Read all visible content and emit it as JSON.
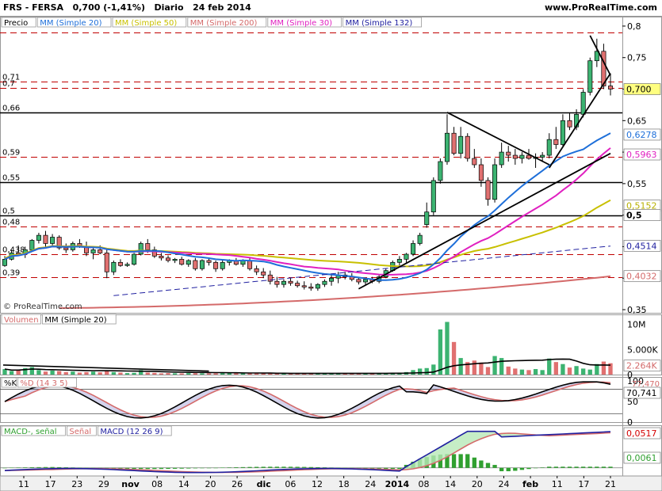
{
  "header": {
    "title": "FRS - FERSA",
    "price_change": "0,700 (-1,41%)",
    "period": "Diario",
    "date": "24 feb 2014",
    "site": "www.ProRealTime.com"
  },
  "price_legend": [
    {
      "label": "Precio",
      "color": "#000000"
    },
    {
      "label": "MM (Simple 20)",
      "color": "#1e6fd9"
    },
    {
      "label": "MM (Simple 50)",
      "color": "#c8c000"
    },
    {
      "label": "MM (Simple 200)",
      "color": "#d46a6a"
    },
    {
      "label": "MM (Simple 30)",
      "color": "#e020c0"
    },
    {
      "label": "MM (Simple 132)",
      "color": "#2020a0"
    }
  ],
  "price_axis_ticks": [
    "0,8",
    "0,75",
    "0,7",
    "0,65",
    "0,6",
    "0,55",
    "0,5",
    "0,45",
    "0,4",
    "0,35"
  ],
  "price_axis_markers": [
    {
      "label": "0,700",
      "bg": "#ffff80",
      "fg": "#000000",
      "value": 0.7
    },
    {
      "label": "0,6278",
      "bg": "#ffffff",
      "fg": "#1e6fd9",
      "value": 0.6278
    },
    {
      "label": "0,5963",
      "bg": "#ffffff",
      "fg": "#e020c0",
      "value": 0.5963
    },
    {
      "label": "0,5152",
      "bg": "#ffffff",
      "fg": "#b8b000",
      "value": 0.5152
    },
    {
      "label": "0,5",
      "bg": "#ffffff",
      "fg": "#000000",
      "value": 0.5
    },
    {
      "label": "0,4514",
      "bg": "#ffffff",
      "fg": "#2020a0",
      "value": 0.4514
    },
    {
      "label": "0,4032",
      "bg": "#ffffff",
      "fg": "#d46a6a",
      "value": 0.4032
    }
  ],
  "level_lines": [
    {
      "label": "0,71",
      "value": 0.712,
      "style": "dashed-red"
    },
    {
      "label": "0,7",
      "value": 0.702,
      "style": "dashed-red"
    },
    {
      "label": "0,66",
      "value": 0.663,
      "style": "solid-black"
    },
    {
      "label": "0,59",
      "value": 0.592,
      "style": "dashed-red"
    },
    {
      "label": "0,55",
      "value": 0.552,
      "style": "solid-black"
    },
    {
      "label": "0,5",
      "value": 0.5,
      "style": "solid-black"
    },
    {
      "label": "0,48",
      "value": 0.482,
      "style": "dashed-red"
    },
    {
      "label": "0,438",
      "value": 0.438,
      "style": "dashed-red"
    },
    {
      "label": "0,39",
      "value": 0.401,
      "style": "dashed-red"
    },
    {
      "label": "",
      "value": 0.79,
      "style": "dashed-red"
    }
  ],
  "copyright": "© ProRealTime.com",
  "volume_panel": {
    "legend": [
      {
        "label": "Volumen",
        "color": "#d46a6a"
      },
      {
        "label": "MM (Simple 20)",
        "color": "#000000"
      }
    ],
    "ticks": [
      "10M",
      "5.000K",
      "0"
    ],
    "marker": "2.264K"
  },
  "stoch_panel": {
    "legend": [
      {
        "label": "%K",
        "color": "#000000"
      },
      {
        "label": "%D (14 3 5)",
        "color": "#d46a6a"
      }
    ],
    "ticks": [
      "100",
      "50",
      "0"
    ],
    "marker_top": "77,470",
    "marker": "70,741"
  },
  "macd_panel": {
    "legend": [
      {
        "label": "MACD-, señal",
        "color": "#30a030"
      },
      {
        "label": "Señal",
        "color": "#d46a6a"
      },
      {
        "label": "MACD (12 26 9)",
        "color": "#2020a0"
      }
    ],
    "marker_top": "0,0517",
    "marker_bottom": "0,0061"
  },
  "x_labels": [
    "11",
    "17",
    "23",
    "29",
    "nov",
    "08",
    "14",
    "20",
    "26",
    "dic",
    "06",
    "12",
    "18",
    "24",
    "2014",
    "08",
    "14",
    "20",
    "24",
    "feb",
    "11",
    "17",
    "21"
  ],
  "chart_data": {
    "type": "candlestick",
    "title": "FRS - FERSA 0,700 (-1,41%) Diario 24 feb 2014",
    "ylim": [
      0.345,
      0.815
    ],
    "candles": [
      [
        0.42,
        0.435,
        0.418,
        0.43
      ],
      [
        0.43,
        0.445,
        0.428,
        0.44
      ],
      [
        0.44,
        0.452,
        0.435,
        0.438
      ],
      [
        0.438,
        0.45,
        0.432,
        0.445
      ],
      [
        0.445,
        0.462,
        0.442,
        0.46
      ],
      [
        0.46,
        0.472,
        0.455,
        0.468
      ],
      [
        0.468,
        0.475,
        0.448,
        0.455
      ],
      [
        0.455,
        0.47,
        0.452,
        0.465
      ],
      [
        0.465,
        0.468,
        0.445,
        0.448
      ],
      [
        0.448,
        0.455,
        0.44,
        0.445
      ],
      [
        0.445,
        0.458,
        0.442,
        0.455
      ],
      [
        0.455,
        0.462,
        0.448,
        0.45
      ],
      [
        0.45,
        0.458,
        0.435,
        0.44
      ],
      [
        0.44,
        0.45,
        0.43,
        0.445
      ],
      [
        0.445,
        0.452,
        0.438,
        0.44
      ],
      [
        0.44,
        0.445,
        0.4,
        0.41
      ],
      [
        0.41,
        0.428,
        0.405,
        0.425
      ],
      [
        0.425,
        0.43,
        0.418,
        0.42
      ],
      [
        0.42,
        0.425,
        0.418,
        0.422
      ],
      [
        0.422,
        0.44,
        0.42,
        0.438
      ],
      [
        0.438,
        0.458,
        0.436,
        0.455
      ],
      [
        0.455,
        0.462,
        0.44,
        0.445
      ],
      [
        0.445,
        0.45,
        0.432,
        0.435
      ],
      [
        0.435,
        0.44,
        0.428,
        0.432
      ],
      [
        0.432,
        0.436,
        0.425,
        0.428
      ],
      [
        0.428,
        0.432,
        0.424,
        0.43
      ],
      [
        0.43,
        0.434,
        0.42,
        0.422
      ],
      [
        0.422,
        0.43,
        0.418,
        0.428
      ],
      [
        0.428,
        0.432,
        0.412,
        0.415
      ],
      [
        0.415,
        0.43,
        0.412,
        0.428
      ],
      [
        0.428,
        0.432,
        0.42,
        0.425
      ],
      [
        0.425,
        0.428,
        0.41,
        0.415
      ],
      [
        0.415,
        0.428,
        0.412,
        0.425
      ],
      [
        0.425,
        0.43,
        0.42,
        0.428
      ],
      [
        0.428,
        0.432,
        0.42,
        0.422
      ],
      [
        0.422,
        0.43,
        0.418,
        0.428
      ],
      [
        0.428,
        0.432,
        0.412,
        0.415
      ],
      [
        0.415,
        0.42,
        0.405,
        0.41
      ],
      [
        0.41,
        0.416,
        0.4,
        0.405
      ],
      [
        0.405,
        0.412,
        0.39,
        0.395
      ],
      [
        0.395,
        0.402,
        0.385,
        0.39
      ],
      [
        0.39,
        0.398,
        0.385,
        0.395
      ],
      [
        0.395,
        0.4,
        0.388,
        0.392
      ],
      [
        0.392,
        0.396,
        0.385,
        0.388
      ],
      [
        0.388,
        0.395,
        0.382,
        0.386
      ],
      [
        0.386,
        0.392,
        0.38,
        0.384
      ],
      [
        0.384,
        0.392,
        0.38,
        0.39
      ],
      [
        0.39,
        0.398,
        0.386,
        0.395
      ],
      [
        0.395,
        0.405,
        0.388,
        0.4
      ],
      [
        0.4,
        0.41,
        0.392,
        0.405
      ],
      [
        0.405,
        0.41,
        0.398,
        0.402
      ],
      [
        0.402,
        0.408,
        0.395,
        0.398
      ],
      [
        0.398,
        0.402,
        0.39,
        0.394
      ],
      [
        0.394,
        0.4,
        0.388,
        0.398
      ],
      [
        0.398,
        0.402,
        0.392,
        0.395
      ],
      [
        0.395,
        0.405,
        0.392,
        0.402
      ],
      [
        0.402,
        0.415,
        0.4,
        0.412
      ],
      [
        0.412,
        0.428,
        0.41,
        0.425
      ],
      [
        0.425,
        0.435,
        0.42,
        0.43
      ],
      [
        0.43,
        0.44,
        0.425,
        0.438
      ],
      [
        0.438,
        0.46,
        0.435,
        0.455
      ],
      [
        0.455,
        0.472,
        0.452,
        0.468
      ],
      [
        0.485,
        0.52,
        0.48,
        0.505
      ],
      [
        0.505,
        0.56,
        0.5,
        0.555
      ],
      [
        0.555,
        0.59,
        0.55,
        0.585
      ],
      [
        0.585,
        0.66,
        0.58,
        0.63
      ],
      [
        0.63,
        0.64,
        0.595,
        0.598
      ],
      [
        0.598,
        0.64,
        0.59,
        0.625
      ],
      [
        0.625,
        0.63,
        0.585,
        0.59
      ],
      [
        0.59,
        0.605,
        0.575,
        0.58
      ],
      [
        0.58,
        0.59,
        0.545,
        0.555
      ],
      [
        0.555,
        0.56,
        0.515,
        0.525
      ],
      [
        0.525,
        0.59,
        0.52,
        0.58
      ],
      [
        0.58,
        0.615,
        0.575,
        0.6
      ],
      [
        0.6,
        0.61,
        0.585,
        0.595
      ],
      [
        0.595,
        0.605,
        0.58,
        0.59
      ],
      [
        0.59,
        0.6,
        0.582,
        0.595
      ],
      [
        0.595,
        0.605,
        0.588,
        0.59
      ],
      [
        0.59,
        0.598,
        0.575,
        0.592
      ],
      [
        0.592,
        0.6,
        0.585,
        0.595
      ],
      [
        0.595,
        0.63,
        0.59,
        0.62
      ],
      [
        0.62,
        0.64,
        0.605,
        0.612
      ],
      [
        0.612,
        0.66,
        0.61,
        0.65
      ],
      [
        0.65,
        0.662,
        0.635,
        0.64
      ],
      [
        0.64,
        0.668,
        0.635,
        0.66
      ],
      [
        0.66,
        0.7,
        0.655,
        0.695
      ],
      [
        0.695,
        0.75,
        0.69,
        0.745
      ],
      [
        0.745,
        0.78,
        0.735,
        0.76
      ],
      [
        0.76,
        0.772,
        0.7,
        0.705
      ],
      [
        0.705,
        0.725,
        0.69,
        0.7
      ]
    ]
  }
}
